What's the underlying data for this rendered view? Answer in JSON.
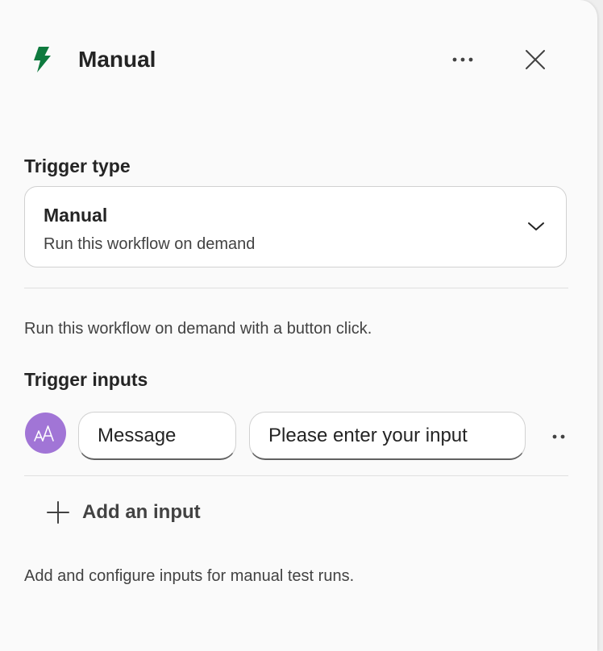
{
  "header": {
    "title": "Manual",
    "icon": "lightning-bolt-icon",
    "more_icon": "more-horizontal-icon",
    "close_icon": "close-icon"
  },
  "trigger_type": {
    "label": "Trigger type",
    "selected_title": "Manual",
    "selected_description": "Run this workflow on demand",
    "chevron_icon": "chevron-down-icon"
  },
  "description": "Run this workflow on demand with a button click.",
  "trigger_inputs": {
    "label": "Trigger inputs",
    "inputs": [
      {
        "type_icon": "text-type-icon",
        "name": "Message",
        "placeholder": "Please enter your input"
      }
    ],
    "add_label": "Add an input",
    "add_icon": "plus-icon"
  },
  "footer_text": "Add and configure inputs for manual test runs.",
  "colors": {
    "bolt_green": "#0e7a3e",
    "avatar_purple": "#a175d6",
    "panel_bg": "#fafafa",
    "text_primary": "#242424"
  }
}
